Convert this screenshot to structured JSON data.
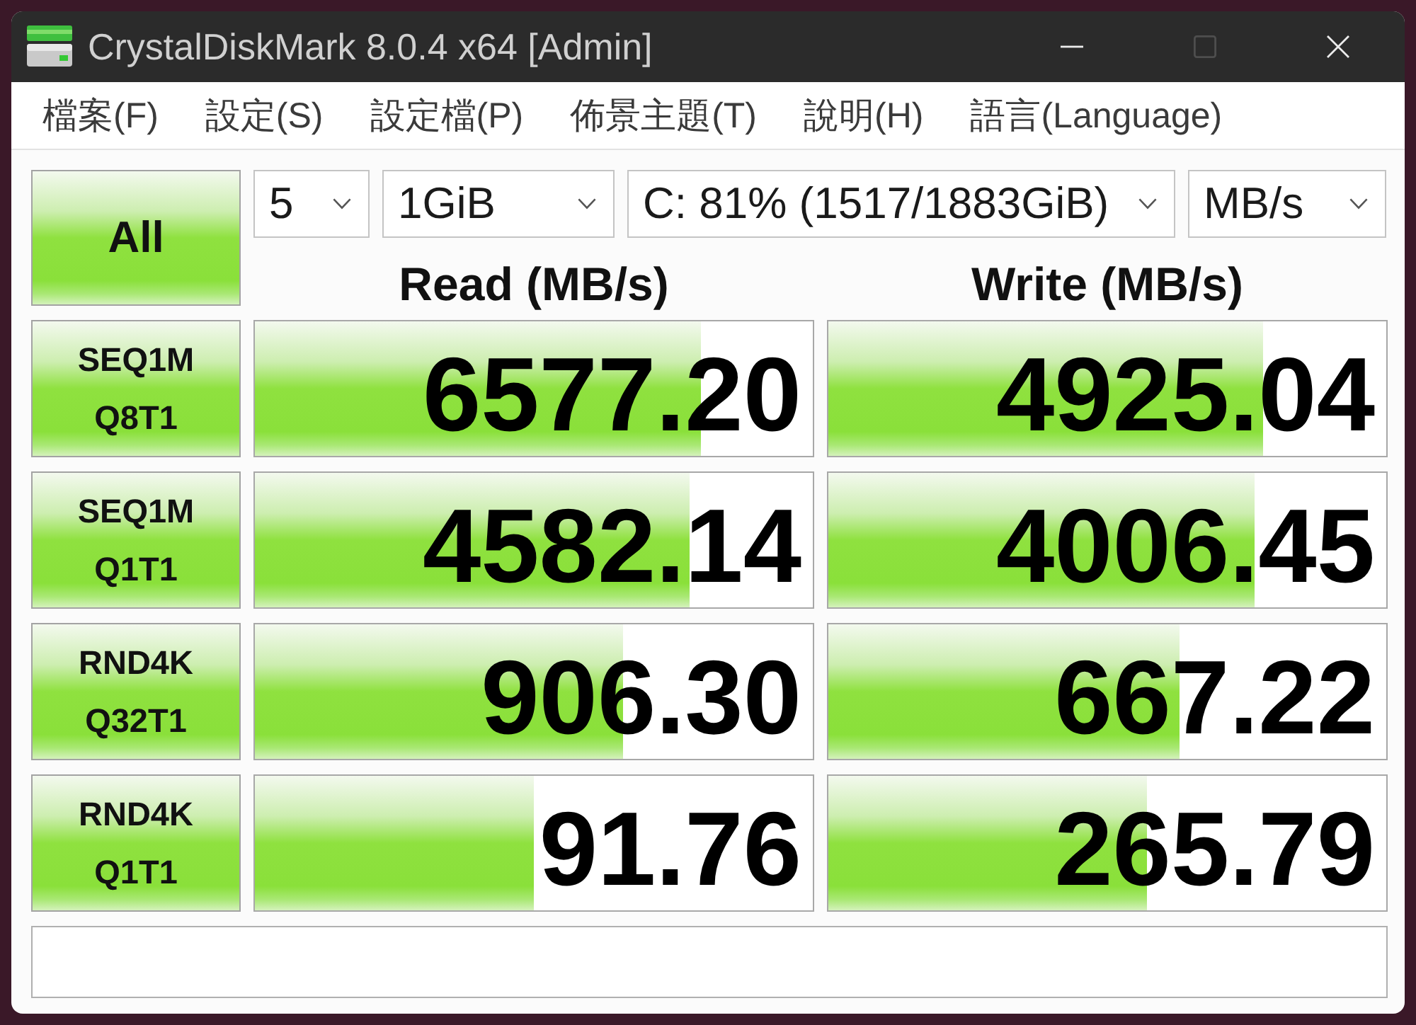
{
  "window": {
    "title": "CrystalDiskMark 8.0.4 x64 [Admin]",
    "controls": [
      {
        "kind": "minimize",
        "disabled": false
      },
      {
        "kind": "maximize",
        "disabled": true
      },
      {
        "kind": "close",
        "disabled": false
      }
    ]
  },
  "menu": [
    "檔案(F)",
    "設定(S)",
    "設定檔(P)",
    "佈景主題(T)",
    "說明(H)",
    "語言(Language)"
  ],
  "all_button": "All",
  "selects": [
    "5",
    "1GiB",
    "C: 81% (1517/1883GiB)",
    "MB/s"
  ],
  "columns": [
    "Read (MB/s)",
    "Write (MB/s)"
  ],
  "tests": [
    {
      "label": [
        "SEQ1M",
        "Q8T1"
      ],
      "read": {
        "value": "6577.20",
        "level": 0.8
      },
      "write": {
        "value": "4925.04",
        "level": 0.78
      }
    },
    {
      "label": [
        "SEQ1M",
        "Q1T1"
      ],
      "read": {
        "value": "4582.14",
        "level": 0.78
      },
      "write": {
        "value": "4006.45",
        "level": 0.765
      }
    },
    {
      "label": [
        "RND4K",
        "Q32T1"
      ],
      "read": {
        "value": "906.30",
        "level": 0.66
      },
      "write": {
        "value": "667.22",
        "level": 0.63
      }
    },
    {
      "label": [
        "RND4K",
        "Q1T1"
      ],
      "read": {
        "value": "91.76",
        "level": 0.5
      },
      "write": {
        "value": "265.79",
        "level": 0.57
      }
    }
  ]
}
